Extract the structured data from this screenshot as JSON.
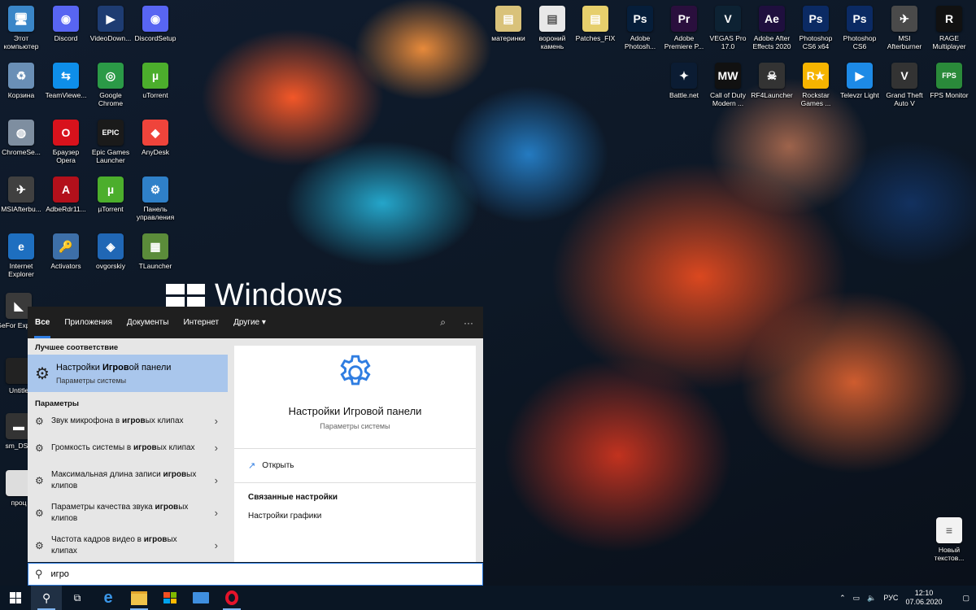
{
  "desktop": {
    "watermark": "Windows",
    "icons_left": [
      {
        "label": "Этот компьютер",
        "icon": "computer-icon",
        "color": "#3a86c8",
        "glyph": "🖥"
      },
      {
        "label": "Discord",
        "icon": "discord-icon",
        "color": "#5865f2",
        "glyph": "◉"
      },
      {
        "label": "VideoDown...",
        "icon": "video-downloader-icon",
        "color": "#1e3c72",
        "glyph": "▶"
      },
      {
        "label": "DiscordSetup",
        "icon": "discord-setup-icon",
        "color": "#5865f2",
        "glyph": "◉"
      },
      {
        "label": "Корзина",
        "icon": "recycle-bin-icon",
        "color": "#6a8fb6",
        "glyph": "♻"
      },
      {
        "label": "TeamViewe...",
        "icon": "teamviewer-icon",
        "color": "#0e8ee9",
        "glyph": "⇆"
      },
      {
        "label": "Google Chrome",
        "icon": "chrome-icon",
        "color": "#2b9a47",
        "glyph": "◎"
      },
      {
        "label": "uTorrent",
        "icon": "utorrent-icon",
        "color": "#4cae2c",
        "glyph": "µ"
      },
      {
        "label": "ChromeSe...",
        "icon": "chrome-setup-icon",
        "color": "#7e8ea0",
        "glyph": "◍"
      },
      {
        "label": "Браузер Opera",
        "icon": "opera-icon",
        "color": "#d8121c",
        "glyph": "O"
      },
      {
        "label": "Epic Games Launcher",
        "icon": "epic-games-icon",
        "color": "#1a1a1a",
        "glyph": "EPIC"
      },
      {
        "label": "AnyDesk",
        "icon": "anydesk-icon",
        "color": "#ef443b",
        "glyph": "◆"
      },
      {
        "label": "MSIAfterbu...",
        "icon": "msi-afterburner-icon",
        "color": "#404040",
        "glyph": "✈"
      },
      {
        "label": "AdbeRdr11...",
        "icon": "adobe-reader-icon",
        "color": "#b3101b",
        "glyph": "A"
      },
      {
        "label": "µTorrent",
        "icon": "mutorrent-icon",
        "color": "#4cae2c",
        "glyph": "µ"
      },
      {
        "label": "Панель управления",
        "icon": "control-panel-icon",
        "color": "#2f80c8",
        "glyph": "⚙"
      },
      {
        "label": "Internet Explorer",
        "icon": "internet-explorer-icon",
        "color": "#1e6fc0",
        "glyph": "e"
      },
      {
        "label": "Activators",
        "icon": "activators-icon",
        "color": "#3d6fa8",
        "glyph": "🔑"
      },
      {
        "label": "ovgorskiy",
        "icon": "ovgorskiy-icon",
        "color": "#2067b5",
        "glyph": "◈"
      },
      {
        "label": "TLauncher",
        "icon": "tlauncher-icon",
        "color": "#5b8c3a",
        "glyph": "▦"
      }
    ],
    "icons_partial": [
      {
        "label": "GeFor Experie",
        "icon": "geforce-icon",
        "color": "#3a3a3a",
        "glyph": "◣"
      },
      {
        "label": "Untitle",
        "icon": "untitled-icon",
        "color": "#222",
        "glyph": ""
      },
      {
        "label": "sm_DSF",
        "icon": "dsf-icon",
        "color": "#333",
        "glyph": "▬"
      },
      {
        "label": "проц",
        "icon": "processor-icon",
        "color": "#ddd",
        "glyph": ""
      }
    ],
    "icons_top_right": [
      {
        "label": "материнки",
        "icon": "folder-icon",
        "color": "#d9c27a",
        "glyph": "▤"
      },
      {
        "label": "вороний камень",
        "icon": "file-icon",
        "color": "#e8e8e8",
        "glyph": "▤"
      },
      {
        "label": "Patches_FIX",
        "icon": "folder-icon",
        "color": "#e6cf6c",
        "glyph": "▤"
      },
      {
        "label": "Adobe Photosh...",
        "icon": "photoshop-icon",
        "color": "#061e3a",
        "glyph": "Ps"
      },
      {
        "label": "Adobe Premiere P...",
        "icon": "premiere-icon",
        "color": "#2a0f3d",
        "glyph": "Pr"
      },
      {
        "label": "VEGAS Pro 17.0",
        "icon": "vegas-icon",
        "color": "#0d2233",
        "glyph": "V"
      },
      {
        "label": "Adobe After Effects 2020",
        "icon": "after-effects-icon",
        "color": "#1f0f3e",
        "glyph": "Ae"
      },
      {
        "label": "Photoshop CS6 x64",
        "icon": "photoshop-cs6-x64-icon",
        "color": "#0b2a63",
        "glyph": "Ps"
      },
      {
        "label": "Photoshop CS6",
        "icon": "photoshop-cs6-icon",
        "color": "#0b2a63",
        "glyph": "Ps"
      },
      {
        "label": "MSI Afterburner",
        "icon": "msi-afterburner-icon",
        "color": "#4a4a4a",
        "glyph": "✈"
      },
      {
        "label": "RAGE Multiplayer",
        "icon": "rage-mp-icon",
        "color": "#111",
        "glyph": "R"
      }
    ],
    "icons_top_right_row2": [
      {
        "label": "Battle.net",
        "icon": "battlenet-icon",
        "color": "#0b1c33",
        "glyph": "✦"
      },
      {
        "label": "Call of Duty Modern ...",
        "icon": "cod-icon",
        "color": "#111",
        "glyph": "MW"
      },
      {
        "label": "RF4Launcher",
        "icon": "rf4-icon",
        "color": "#333",
        "glyph": "☠"
      },
      {
        "label": "Rockstar Games ...",
        "icon": "rockstar-icon",
        "color": "#f6b400",
        "glyph": "R★"
      },
      {
        "label": "Televzr Light",
        "icon": "televzr-icon",
        "color": "#1d8ae6",
        "glyph": "▶"
      },
      {
        "label": "Grand Theft Auto V",
        "icon": "gta-icon",
        "color": "#333",
        "glyph": "V"
      },
      {
        "label": "FPS Monitor",
        "icon": "fps-monitor-icon",
        "color": "#2a8a3a",
        "glyph": "FPS"
      }
    ],
    "icon_bottom_right": {
      "label": "Новый текстов...",
      "icon": "text-document-icon",
      "color": "#f2f2f2",
      "glyph": "≡"
    }
  },
  "search": {
    "tabs": [
      {
        "label": "Все",
        "active": true
      },
      {
        "label": "Приложения"
      },
      {
        "label": "Документы"
      },
      {
        "label": "Интернет"
      },
      {
        "label": "Другие ▾"
      }
    ],
    "best_match_heading": "Лучшее соответствие",
    "best_match": {
      "pre": "Настройки ",
      "bold": "Игров",
      "post": "ой панели",
      "subtitle": "Параметры системы"
    },
    "settings_heading": "Параметры",
    "settings_items": [
      {
        "pre": "Звук микрофона в ",
        "bold": "игров",
        "post": "ых клипах"
      },
      {
        "pre": "Громкость системы в ",
        "bold": "игров",
        "post": "ых клипах"
      },
      {
        "pre": "Максимальная длина записи ",
        "bold": "игров",
        "post": "ых клипов"
      },
      {
        "pre": "Параметры качества звука ",
        "bold": "игров",
        "post": "ых клипов"
      },
      {
        "pre": "Частота кадров видео в ",
        "bold": "игров",
        "post": "ых клипах"
      }
    ],
    "preview": {
      "title": "Настройки Игровой панели",
      "subtitle": "Параметры системы",
      "open_label": "Открыть",
      "related_heading": "Связанные настройки",
      "related_link": "Настройки графики"
    },
    "query": "игро"
  },
  "taskbar": {
    "apps": [
      {
        "name": "start",
        "icon": "windows-start-icon"
      },
      {
        "name": "search",
        "icon": "search-icon"
      },
      {
        "name": "task-view",
        "icon": "task-view-icon"
      },
      {
        "name": "edge",
        "icon": "edge-icon"
      },
      {
        "name": "explorer",
        "icon": "file-explorer-icon"
      },
      {
        "name": "store",
        "icon": "store-icon"
      },
      {
        "name": "mail",
        "icon": "mail-icon"
      },
      {
        "name": "opera",
        "icon": "opera-icon"
      }
    ],
    "language": "РУС",
    "time": "12:10",
    "date": "07.06.2020"
  }
}
